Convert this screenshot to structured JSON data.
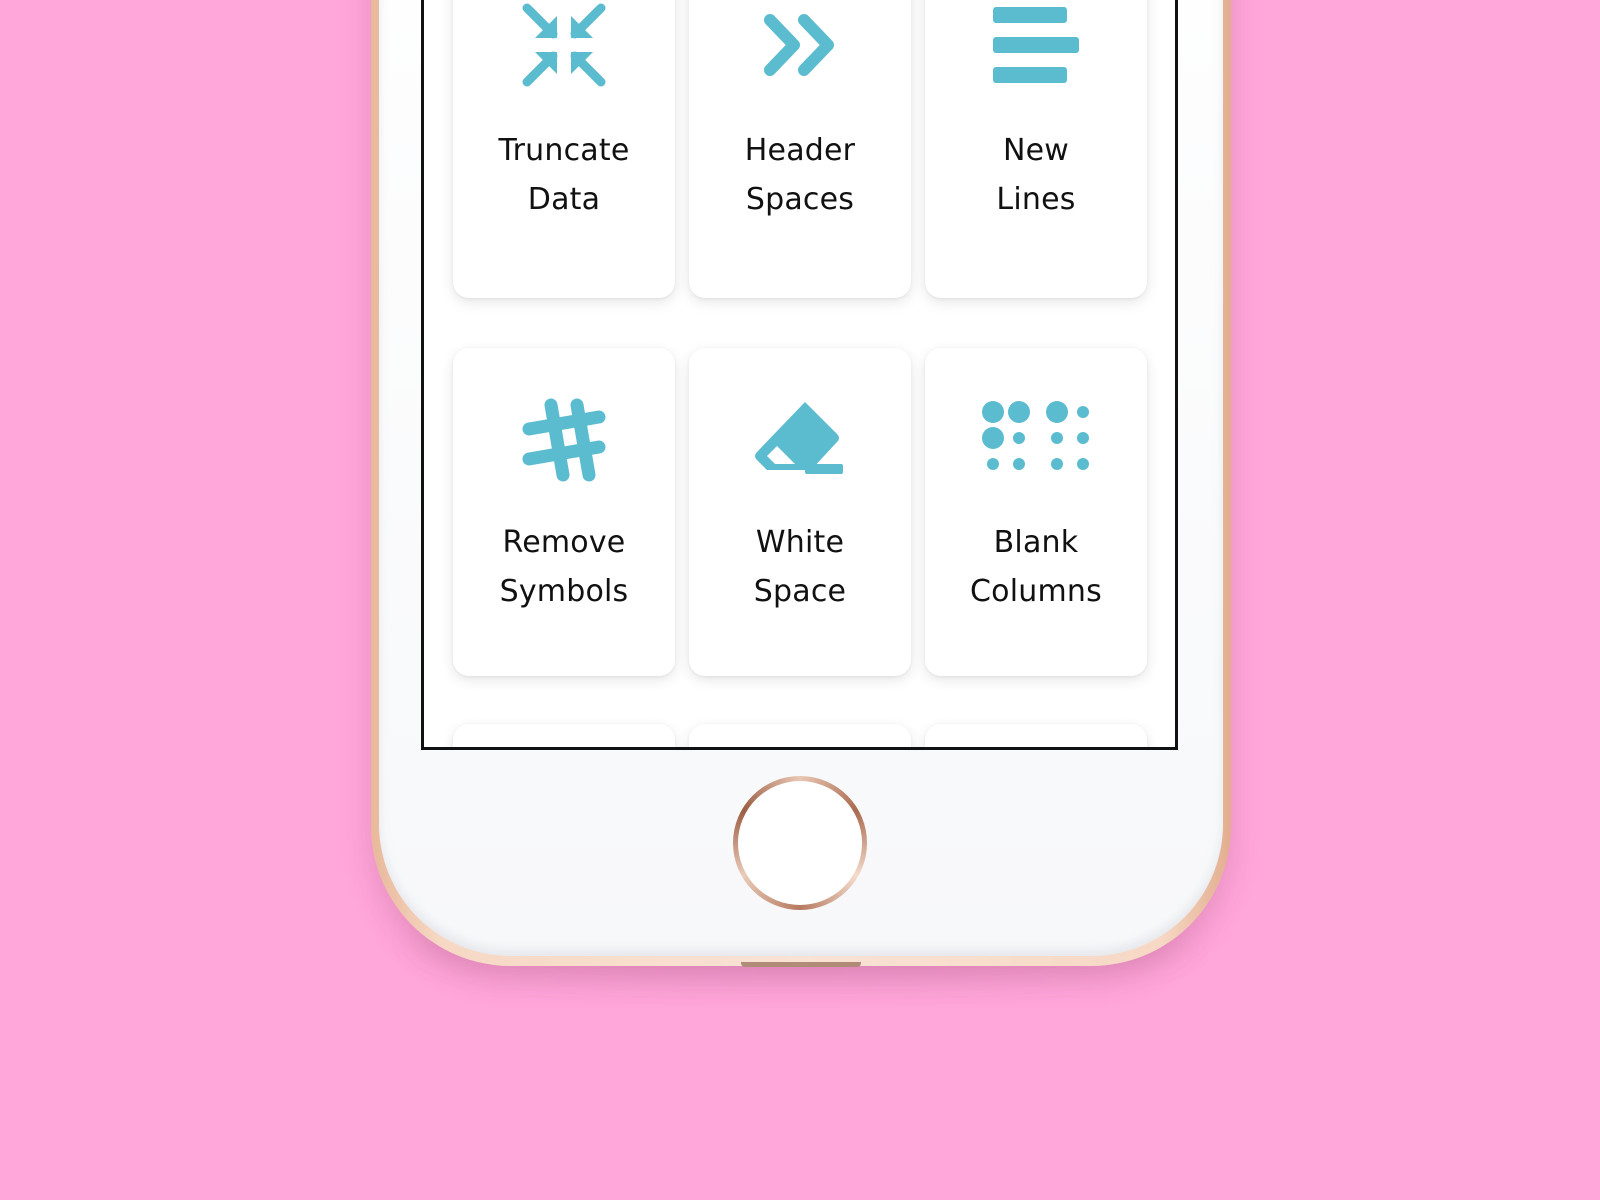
{
  "background_color": "#ffa6da",
  "accent_color": "#5bbccf",
  "phone": {
    "frame_color": "rose-gold",
    "face_color": "#ffffff"
  },
  "tools": [
    {
      "label_line1": "Truncate",
      "label_line2": "Data",
      "icon": "compress-arrows-icon"
    },
    {
      "label_line1": "Header",
      "label_line2": "Spaces",
      "icon": "double-chevron-right-icon"
    },
    {
      "label_line1": "New",
      "label_line2": "Lines",
      "icon": "three-lines-icon"
    },
    {
      "label_line1": "Remove",
      "label_line2": "Symbols",
      "icon": "hashtag-icon"
    },
    {
      "label_line1": "White",
      "label_line2": "Space",
      "icon": "eraser-icon"
    },
    {
      "label_line1": "Blank",
      "label_line2": "Columns",
      "icon": "dot-grid-icon"
    }
  ]
}
